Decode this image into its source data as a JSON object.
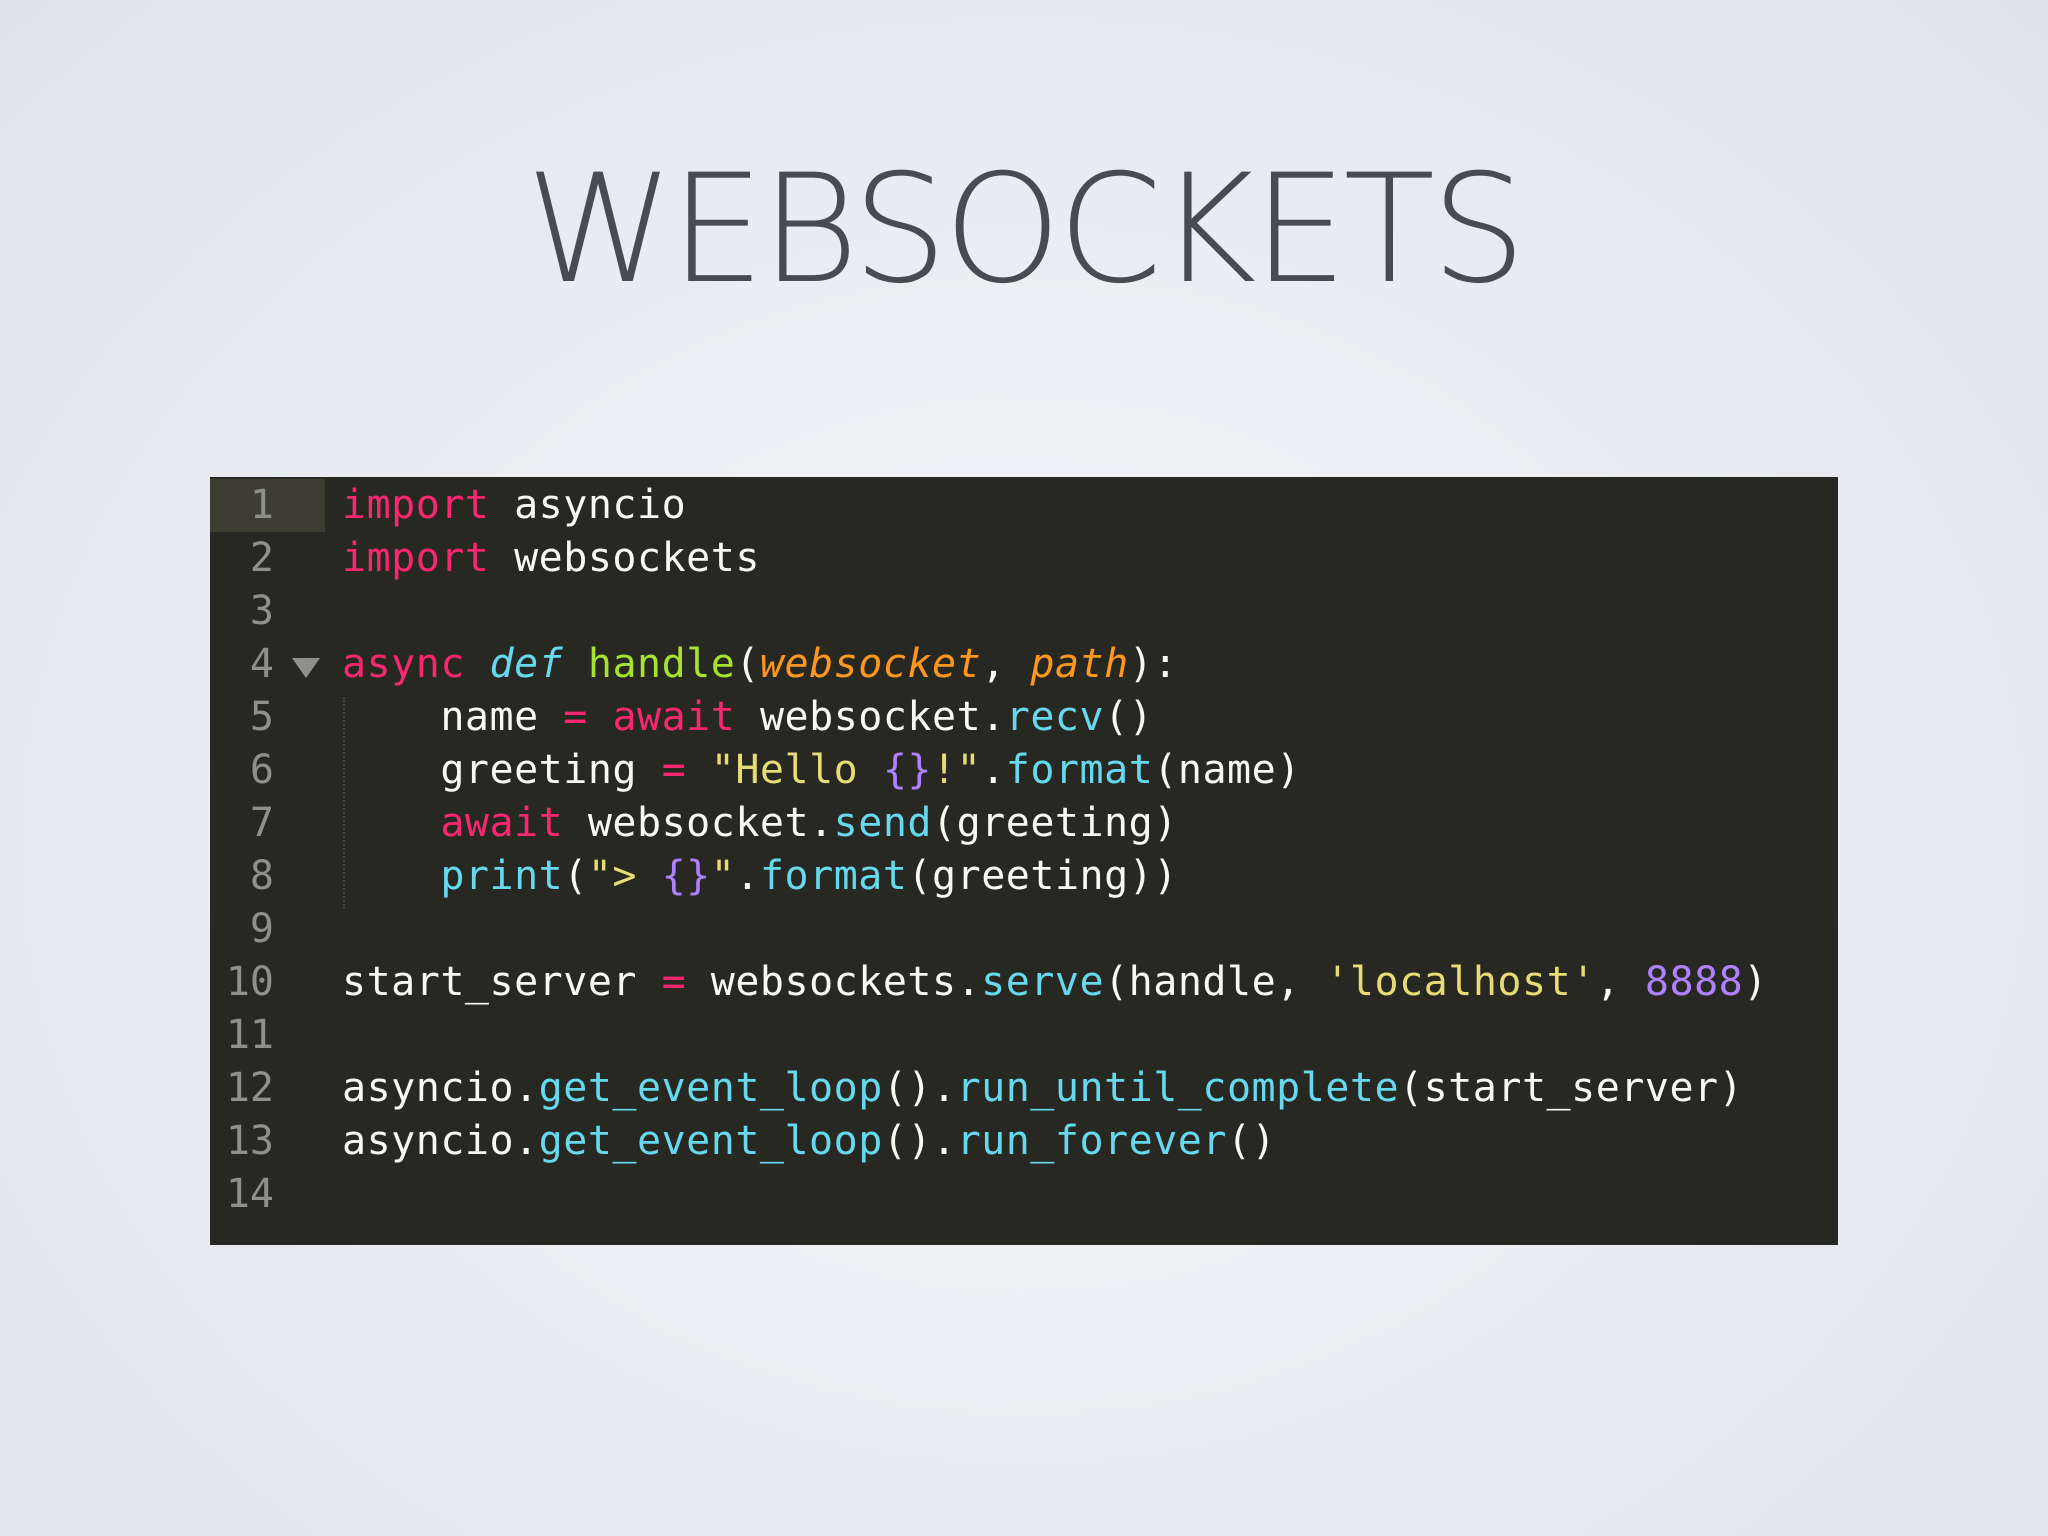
{
  "slide": {
    "title": "WEBSOCKETS"
  },
  "editor": {
    "theme_colors": {
      "background": "#272822",
      "keyword": "#f92672",
      "function_name": "#a6e22e",
      "parameter": "#fd971f",
      "builtin": "#66d9ef",
      "string": "#e6db74",
      "number": "#ae81ff",
      "text": "#f8f8f2",
      "line_number": "#8f908a"
    },
    "fold_icon": "triangle-down-icon",
    "line_numbers": [
      "1",
      "2",
      "3",
      "4",
      "5",
      "6",
      "7",
      "8",
      "9",
      "10",
      "11",
      "12",
      "13",
      "14"
    ],
    "lines": [
      [
        {
          "t": "import",
          "c": "kw"
        },
        {
          "t": " asyncio",
          "c": "tx"
        }
      ],
      [
        {
          "t": "import",
          "c": "kw"
        },
        {
          "t": " websockets",
          "c": "tx"
        }
      ],
      [],
      [
        {
          "t": "async",
          "c": "kw"
        },
        {
          "t": " ",
          "c": "tx"
        },
        {
          "t": "def",
          "c": "st"
        },
        {
          "t": " ",
          "c": "tx"
        },
        {
          "t": "handle",
          "c": "fn"
        },
        {
          "t": "(",
          "c": "tx"
        },
        {
          "t": "websocket",
          "c": "pa"
        },
        {
          "t": ", ",
          "c": "tx"
        },
        {
          "t": "path",
          "c": "pa"
        },
        {
          "t": "):",
          "c": "tx"
        }
      ],
      [
        {
          "t": "    name ",
          "c": "tx"
        },
        {
          "t": "=",
          "c": "op"
        },
        {
          "t": " ",
          "c": "tx"
        },
        {
          "t": "await",
          "c": "kw"
        },
        {
          "t": " websocket.",
          "c": "tx"
        },
        {
          "t": "recv",
          "c": "bi"
        },
        {
          "t": "()",
          "c": "tx"
        }
      ],
      [
        {
          "t": "    greeting ",
          "c": "tx"
        },
        {
          "t": "=",
          "c": "op"
        },
        {
          "t": " ",
          "c": "tx"
        },
        {
          "t": "\"Hello ",
          "c": "str"
        },
        {
          "t": "{}",
          "c": "nu"
        },
        {
          "t": "!\"",
          "c": "str"
        },
        {
          "t": ".",
          "c": "tx"
        },
        {
          "t": "format",
          "c": "bi"
        },
        {
          "t": "(name)",
          "c": "tx"
        }
      ],
      [
        {
          "t": "    ",
          "c": "tx"
        },
        {
          "t": "await",
          "c": "kw"
        },
        {
          "t": " websocket.",
          "c": "tx"
        },
        {
          "t": "send",
          "c": "bi"
        },
        {
          "t": "(greeting)",
          "c": "tx"
        }
      ],
      [
        {
          "t": "    ",
          "c": "tx"
        },
        {
          "t": "print",
          "c": "bi"
        },
        {
          "t": "(",
          "c": "tx"
        },
        {
          "t": "\"> ",
          "c": "str"
        },
        {
          "t": "{}",
          "c": "nu"
        },
        {
          "t": "\"",
          "c": "str"
        },
        {
          "t": ".",
          "c": "tx"
        },
        {
          "t": "format",
          "c": "bi"
        },
        {
          "t": "(greeting))",
          "c": "tx"
        }
      ],
      [],
      [
        {
          "t": "start_server ",
          "c": "tx"
        },
        {
          "t": "=",
          "c": "op"
        },
        {
          "t": " websockets.",
          "c": "tx"
        },
        {
          "t": "serve",
          "c": "bi"
        },
        {
          "t": "(handle, ",
          "c": "tx"
        },
        {
          "t": "'localhost'",
          "c": "str"
        },
        {
          "t": ", ",
          "c": "tx"
        },
        {
          "t": "8888",
          "c": "nu"
        },
        {
          "t": ")",
          "c": "tx"
        }
      ],
      [],
      [
        {
          "t": "asyncio.",
          "c": "tx"
        },
        {
          "t": "get_event_loop",
          "c": "bi"
        },
        {
          "t": "().",
          "c": "tx"
        },
        {
          "t": "run_until_complete",
          "c": "bi"
        },
        {
          "t": "(start_server)",
          "c": "tx"
        }
      ],
      [
        {
          "t": "asyncio.",
          "c": "tx"
        },
        {
          "t": "get_event_loop",
          "c": "bi"
        },
        {
          "t": "().",
          "c": "tx"
        },
        {
          "t": "run_forever",
          "c": "bi"
        },
        {
          "t": "()",
          "c": "tx"
        }
      ],
      []
    ]
  }
}
